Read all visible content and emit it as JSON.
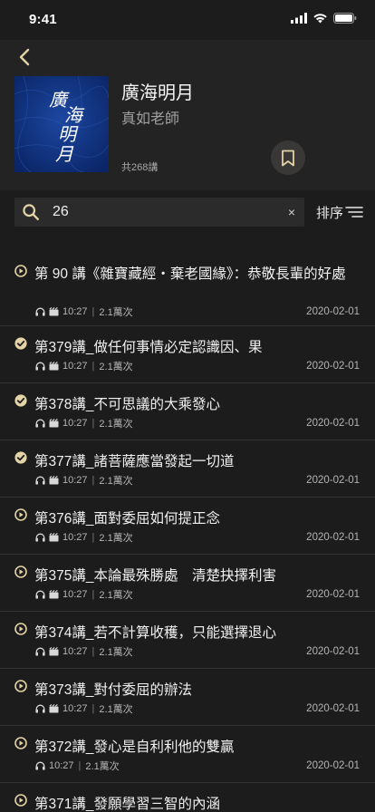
{
  "status": {
    "time": "9:41"
  },
  "album": {
    "title": "廣海明月",
    "author": "真如老師",
    "count": "共268講",
    "cover_text": [
      "廣",
      "海",
      "明",
      "月"
    ]
  },
  "search": {
    "value": "26",
    "clear": "×"
  },
  "sort": {
    "label": "排序"
  },
  "episodes": [
    {
      "title": "第 90 講《雜寶藏經・棄老國緣》：恭敬長輩的好處",
      "duration": "10:27",
      "plays": "2.1萬次",
      "date": "2020-02-01",
      "state": "play",
      "video": true
    },
    {
      "title": "第379講_做任何事情必定認識因、果",
      "duration": "10:27",
      "plays": "2.1萬次",
      "date": "2020-02-01",
      "state": "done",
      "video": true
    },
    {
      "title": "第378講_不可思議的大乘發心",
      "duration": "10:27",
      "plays": "2.1萬次",
      "date": "2020-02-01",
      "state": "done",
      "video": true
    },
    {
      "title": "第377講_諸菩薩應當發起一切道",
      "duration": "10:27",
      "plays": "2.1萬次",
      "date": "2020-02-01",
      "state": "done",
      "video": true
    },
    {
      "title": "第376講_面對委屈如何提正念",
      "duration": "10:27",
      "plays": "2.1萬次",
      "date": "2020-02-01",
      "state": "play",
      "video": true
    },
    {
      "title": "第375講_本論最殊勝處　清楚抉擇利害",
      "duration": "10:27",
      "plays": "2.1萬次",
      "date": "2020-02-01",
      "state": "play",
      "video": true
    },
    {
      "title": "第374講_若不計算收穫，只能選擇退心",
      "duration": "10:27",
      "plays": "2.1萬次",
      "date": "2020-02-01",
      "state": "play",
      "video": true
    },
    {
      "title": "第373講_對付委屈的辦法",
      "duration": "10:27",
      "plays": "2.1萬次",
      "date": "2020-02-01",
      "state": "play",
      "video": true
    },
    {
      "title": "第372講_發心是自利利他的雙贏",
      "duration": "10:27",
      "plays": "2.1萬次",
      "date": "2020-02-01",
      "state": "play",
      "video": false
    },
    {
      "title": "第371講_發願學習三智的內涵",
      "duration": "",
      "plays": "",
      "date": "",
      "state": "play",
      "video": false
    }
  ],
  "colors": {
    "accent": "#e3d3a6",
    "background": "#1c1c1c",
    "header_bg": "#232323",
    "cover_blue": "#10327a"
  },
  "icons": {
    "back": "chevron-left-icon",
    "bookmark": "bookmark-icon",
    "search": "search-icon",
    "sort": "sort-icon",
    "play": "play-circle-icon",
    "done": "check-circle-icon",
    "audio": "headphones-icon",
    "video": "video-icon"
  }
}
